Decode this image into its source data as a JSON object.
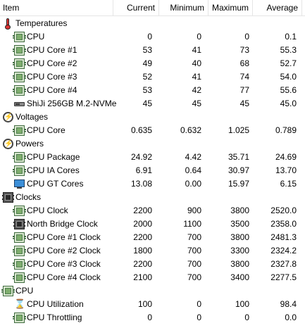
{
  "columns": {
    "item": "Item",
    "current": "Current",
    "minimum": "Minimum",
    "maximum": "Maximum",
    "average": "Average"
  },
  "rows": [
    {
      "type": "group",
      "icon": "thermometer-icon",
      "label": "Temperatures"
    },
    {
      "type": "item",
      "icon": "cpu-chip-icon",
      "label": "CPU",
      "current": "0",
      "minimum": "0",
      "maximum": "0",
      "average": "0.1"
    },
    {
      "type": "item",
      "icon": "cpu-chip-icon",
      "label": "CPU Core #1",
      "current": "53",
      "minimum": "41",
      "maximum": "73",
      "average": "55.3"
    },
    {
      "type": "item",
      "icon": "cpu-chip-icon",
      "label": "CPU Core #2",
      "current": "49",
      "minimum": "40",
      "maximum": "68",
      "average": "52.7"
    },
    {
      "type": "item",
      "icon": "cpu-chip-icon",
      "label": "CPU Core #3",
      "current": "52",
      "minimum": "41",
      "maximum": "74",
      "average": "54.0"
    },
    {
      "type": "item",
      "icon": "cpu-chip-icon",
      "label": "CPU Core #4",
      "current": "53",
      "minimum": "42",
      "maximum": "77",
      "average": "55.6"
    },
    {
      "type": "item",
      "icon": "drive-icon",
      "label": "ShiJi 256GB M.2-NVMe",
      "current": "45",
      "minimum": "45",
      "maximum": "45",
      "average": "45.0"
    },
    {
      "type": "group",
      "icon": "voltage-icon",
      "label": "Voltages"
    },
    {
      "type": "item",
      "icon": "cpu-chip-icon",
      "label": "CPU Core",
      "current": "0.635",
      "minimum": "0.632",
      "maximum": "1.025",
      "average": "0.789"
    },
    {
      "type": "group",
      "icon": "power-icon",
      "label": "Powers"
    },
    {
      "type": "item",
      "icon": "cpu-chip-icon",
      "label": "CPU Package",
      "current": "24.92",
      "minimum": "4.42",
      "maximum": "35.71",
      "average": "24.69"
    },
    {
      "type": "item",
      "icon": "cpu-chip-icon",
      "label": "CPU IA Cores",
      "current": "6.91",
      "minimum": "0.64",
      "maximum": "30.97",
      "average": "13.70"
    },
    {
      "type": "item",
      "icon": "monitor-icon",
      "label": "CPU GT Cores",
      "current": "13.08",
      "minimum": "0.00",
      "maximum": "15.97",
      "average": "6.15"
    },
    {
      "type": "group",
      "icon": "clock-chip-icon",
      "label": "Clocks"
    },
    {
      "type": "item",
      "icon": "cpu-chip-icon",
      "label": "CPU Clock",
      "current": "2200",
      "minimum": "900",
      "maximum": "3800",
      "average": "2520.0"
    },
    {
      "type": "item",
      "icon": "clock-chip-icon",
      "label": "North Bridge Clock",
      "current": "2000",
      "minimum": "1100",
      "maximum": "3500",
      "average": "2358.0"
    },
    {
      "type": "item",
      "icon": "cpu-chip-icon",
      "label": "CPU Core #1 Clock",
      "current": "2200",
      "minimum": "700",
      "maximum": "3800",
      "average": "2481.3"
    },
    {
      "type": "item",
      "icon": "cpu-chip-icon",
      "label": "CPU Core #2 Clock",
      "current": "1800",
      "minimum": "700",
      "maximum": "3300",
      "average": "2324.2"
    },
    {
      "type": "item",
      "icon": "cpu-chip-icon",
      "label": "CPU Core #3 Clock",
      "current": "2200",
      "minimum": "700",
      "maximum": "3800",
      "average": "2327.8"
    },
    {
      "type": "item",
      "icon": "cpu-chip-icon",
      "label": "CPU Core #4 Clock",
      "current": "2100",
      "minimum": "700",
      "maximum": "3400",
      "average": "2277.5"
    },
    {
      "type": "group",
      "icon": "cpu-chip-icon",
      "label": "CPU"
    },
    {
      "type": "item",
      "icon": "hourglass-icon",
      "label": "CPU Utilization",
      "current": "100",
      "minimum": "0",
      "maximum": "100",
      "average": "98.4"
    },
    {
      "type": "item",
      "icon": "cpu-chip-icon",
      "label": "CPU Throttling",
      "current": "0",
      "minimum": "0",
      "maximum": "0",
      "average": "0.0"
    }
  ]
}
